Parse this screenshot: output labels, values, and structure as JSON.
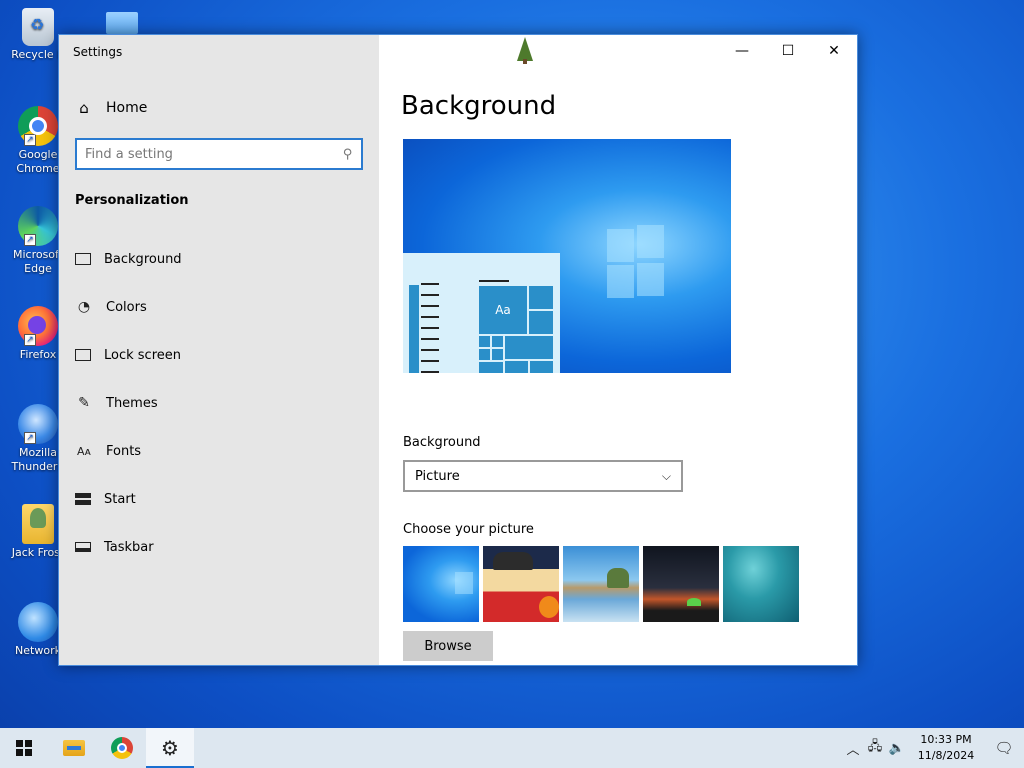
{
  "desktop": {
    "icons": [
      {
        "label": "Recycle B"
      },
      {
        "label": "Google Chrome"
      },
      {
        "label": "Microsoft Edge"
      },
      {
        "label": "Firefox"
      },
      {
        "label": "Mozilla Thunderb"
      },
      {
        "label": "Jack Frost"
      },
      {
        "label": "Network"
      }
    ]
  },
  "window": {
    "title": "Settings",
    "home_label": "Home",
    "search_placeholder": "Find a setting",
    "section_title": "Personalization",
    "nav_items": [
      {
        "label": "Background",
        "icon": "picture-icon"
      },
      {
        "label": "Colors",
        "icon": "palette-icon"
      },
      {
        "label": "Lock screen",
        "icon": "monitor-icon"
      },
      {
        "label": "Themes",
        "icon": "brush-icon"
      },
      {
        "label": "Fonts",
        "icon": "font-icon"
      },
      {
        "label": "Start",
        "icon": "start-icon"
      },
      {
        "label": "Taskbar",
        "icon": "taskbar-icon"
      }
    ],
    "controls": {
      "minimize": "—",
      "maximize": "☐",
      "close": "✕"
    }
  },
  "main": {
    "page_title": "Background",
    "preview_tile_label": "Aa",
    "background_label": "Background",
    "background_value": "Picture",
    "choose_label": "Choose your picture",
    "browse_label": "Browse"
  },
  "taskbar": {
    "time": "10:33 PM",
    "date": "11/8/2024"
  }
}
